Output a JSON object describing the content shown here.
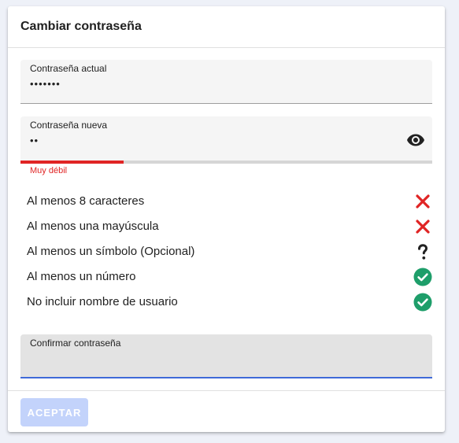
{
  "dialog": {
    "title": "Cambiar contraseña",
    "accept_label": "ACEPTAR"
  },
  "current_password": {
    "label": "Contraseña actual",
    "value": "•••••••"
  },
  "new_password": {
    "label": "Contraseña nueva",
    "value": "••",
    "visibility_icon": "eye-icon",
    "strength_text": "Muy débil",
    "strength_fraction": 0.25,
    "strength_color": "#e02424"
  },
  "rules": [
    {
      "label": "Al menos 8 caracteres",
      "status": "fail",
      "icon": "close-icon"
    },
    {
      "label": "Al menos una mayúscula",
      "status": "fail",
      "icon": "close-icon"
    },
    {
      "label": "Al menos un símbolo (Opcional)",
      "status": "optional",
      "icon": "question-icon"
    },
    {
      "label": "Al menos un número",
      "status": "pass",
      "icon": "check-circle-icon"
    },
    {
      "label": "No incluir nombre de usuario",
      "status": "pass",
      "icon": "check-circle-icon"
    }
  ],
  "confirm_password": {
    "label": "Confirmar contraseña",
    "value": ""
  },
  "colors": {
    "accent": "#3f6ad8",
    "fail": "#e02424",
    "pass": "#1e9e6a",
    "disabled_button": "#c3d3fb"
  }
}
